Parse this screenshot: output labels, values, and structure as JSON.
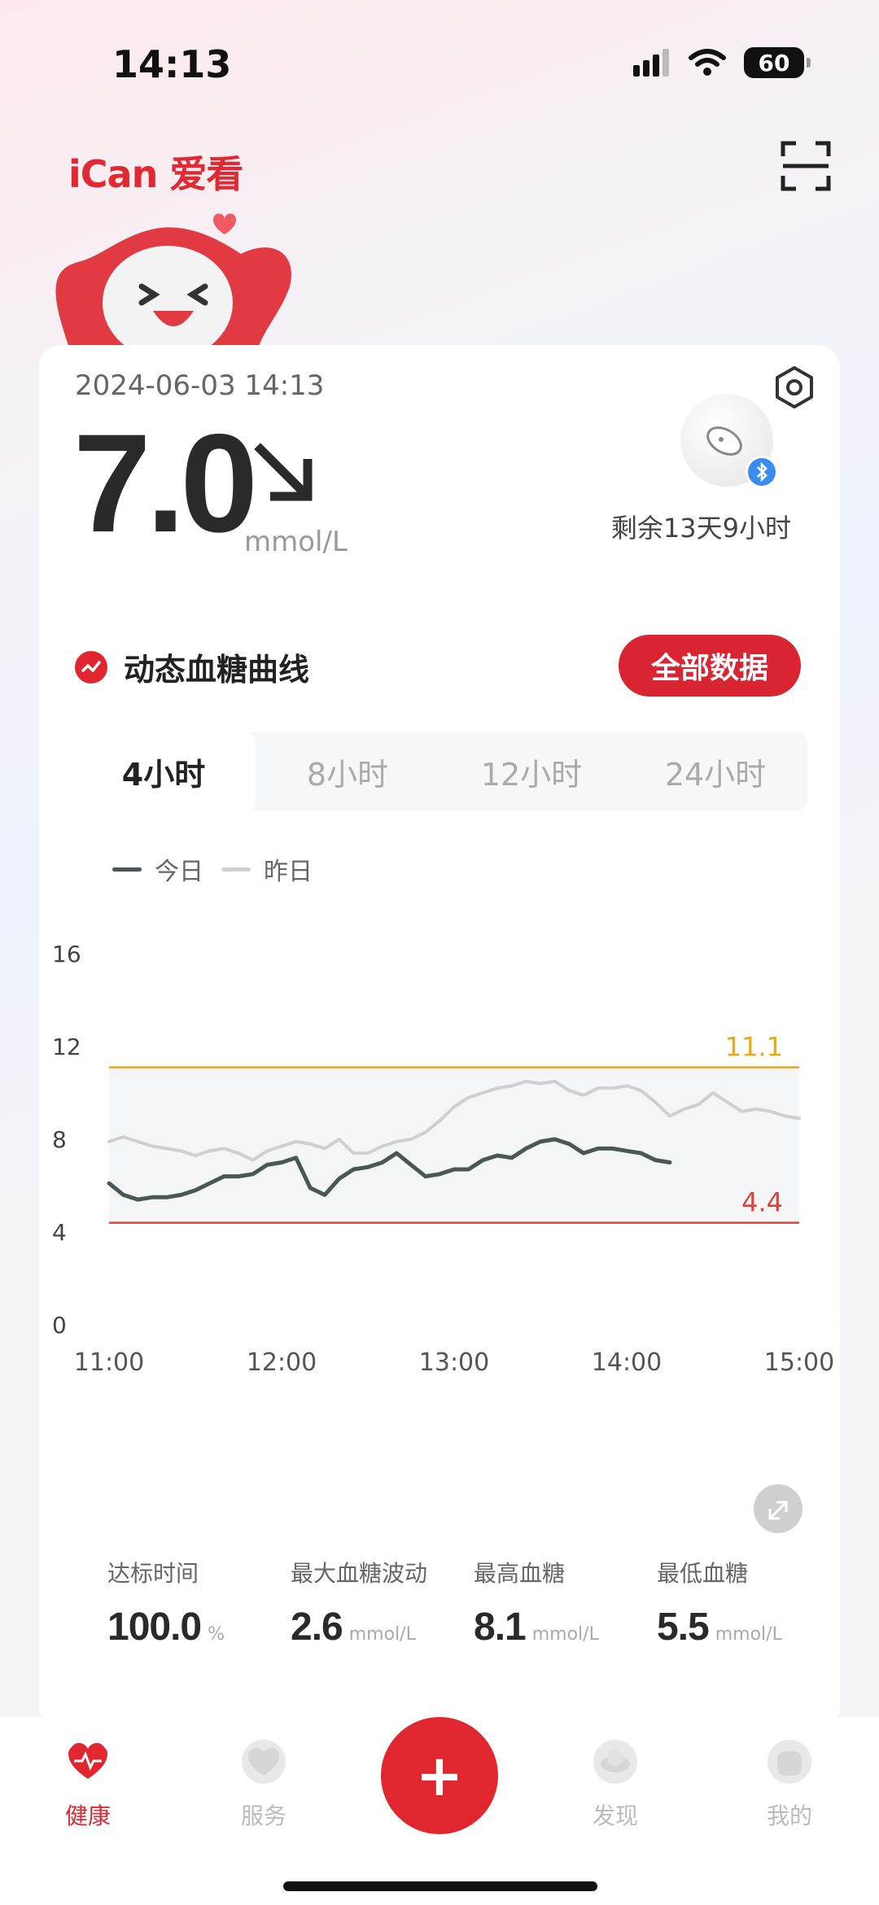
{
  "status_bar": {
    "time": "14:13",
    "battery": "60"
  },
  "header": {
    "logo_text": "iCan 爱看"
  },
  "reading": {
    "timestamp": "2024-06-03 14:13",
    "value": "7.0",
    "unit": "mmol/L",
    "trend": "falling",
    "sensor_remaining": "剩余13天9小时"
  },
  "section": {
    "title": "动态血糖曲线",
    "all_data_label": "全部数据"
  },
  "tabs": [
    {
      "label": "4小时",
      "active": true
    },
    {
      "label": "8小时",
      "active": false
    },
    {
      "label": "12小时",
      "active": false
    },
    {
      "label": "24小时",
      "active": false
    }
  ],
  "legend": {
    "today": "今日",
    "yesterday": "昨日"
  },
  "chart_data": {
    "type": "line",
    "x_ticks": [
      "11:00",
      "12:00",
      "13:00",
      "14:00",
      "15:00"
    ],
    "y_ticks": [
      16,
      12,
      8,
      4,
      0
    ],
    "xlim": [
      "11:00",
      "15:00"
    ],
    "ylim": [
      0,
      16
    ],
    "target_range": [
      4.4,
      11.1
    ],
    "high_label": "11.1",
    "low_label": "4.4",
    "colors": {
      "today": "#4a5757",
      "yesterday": "#cfcfcf",
      "high": "#e6a817",
      "low": "#d9453a"
    },
    "series": [
      {
        "name": "今日",
        "x": [
          "11:00",
          "11:05",
          "11:10",
          "11:15",
          "11:20",
          "11:25",
          "11:30",
          "11:35",
          "11:40",
          "11:45",
          "11:50",
          "11:55",
          "12:00",
          "12:05",
          "12:10",
          "12:15",
          "12:20",
          "12:25",
          "12:30",
          "12:35",
          "12:40",
          "12:45",
          "12:50",
          "12:55",
          "13:00",
          "13:05",
          "13:10",
          "13:15",
          "13:20",
          "13:25",
          "13:30",
          "13:35",
          "13:40",
          "13:45",
          "13:50",
          "13:55",
          "14:00",
          "14:05",
          "14:10",
          "14:15"
        ],
        "values": [
          6.1,
          5.6,
          5.4,
          5.5,
          5.5,
          5.6,
          5.8,
          6.1,
          6.4,
          6.4,
          6.5,
          6.9,
          7.0,
          7.2,
          5.9,
          5.6,
          6.3,
          6.7,
          6.8,
          7.0,
          7.4,
          6.9,
          6.4,
          6.5,
          6.7,
          6.7,
          7.1,
          7.3,
          7.2,
          7.6,
          7.9,
          8.0,
          7.8,
          7.4,
          7.6,
          7.6,
          7.5,
          7.4,
          7.1,
          7.0
        ]
      },
      {
        "name": "昨日",
        "x": [
          "11:00",
          "11:05",
          "11:10",
          "11:15",
          "11:20",
          "11:25",
          "11:30",
          "11:35",
          "11:40",
          "11:45",
          "11:50",
          "11:55",
          "12:00",
          "12:05",
          "12:10",
          "12:15",
          "12:20",
          "12:25",
          "12:30",
          "12:35",
          "12:40",
          "12:45",
          "12:50",
          "12:55",
          "13:00",
          "13:05",
          "13:10",
          "13:15",
          "13:20",
          "13:25",
          "13:30",
          "13:35",
          "13:40",
          "13:45",
          "13:50",
          "13:55",
          "14:00",
          "14:05",
          "14:10",
          "14:15",
          "14:20",
          "14:25",
          "14:30",
          "14:35",
          "14:40",
          "14:45",
          "14:50",
          "14:55",
          "15:00"
        ],
        "values": [
          7.9,
          8.1,
          7.9,
          7.7,
          7.6,
          7.5,
          7.3,
          7.5,
          7.6,
          7.4,
          7.1,
          7.5,
          7.7,
          7.9,
          7.8,
          7.6,
          8.0,
          7.4,
          7.4,
          7.7,
          7.9,
          8.0,
          8.3,
          8.8,
          9.4,
          9.8,
          10.0,
          10.2,
          10.3,
          10.5,
          10.4,
          10.5,
          10.1,
          9.9,
          10.2,
          10.2,
          10.3,
          10.1,
          9.6,
          9.0,
          9.3,
          9.5,
          10.0,
          9.6,
          9.2,
          9.3,
          9.2,
          9.0,
          8.9
        ]
      }
    ]
  },
  "stats": [
    {
      "label": "达标时间",
      "value": "100.0",
      "unit": "%"
    },
    {
      "label": "最大血糖波动",
      "value": "2.6",
      "unit": "mmol/L"
    },
    {
      "label": "最高血糖",
      "value": "8.1",
      "unit": "mmol/L"
    },
    {
      "label": "最低血糖",
      "value": "5.5",
      "unit": "mmol/L"
    }
  ],
  "tabbar": {
    "health": "健康",
    "service": "服务",
    "add": "+",
    "discover": "发现",
    "mine": "我的"
  }
}
